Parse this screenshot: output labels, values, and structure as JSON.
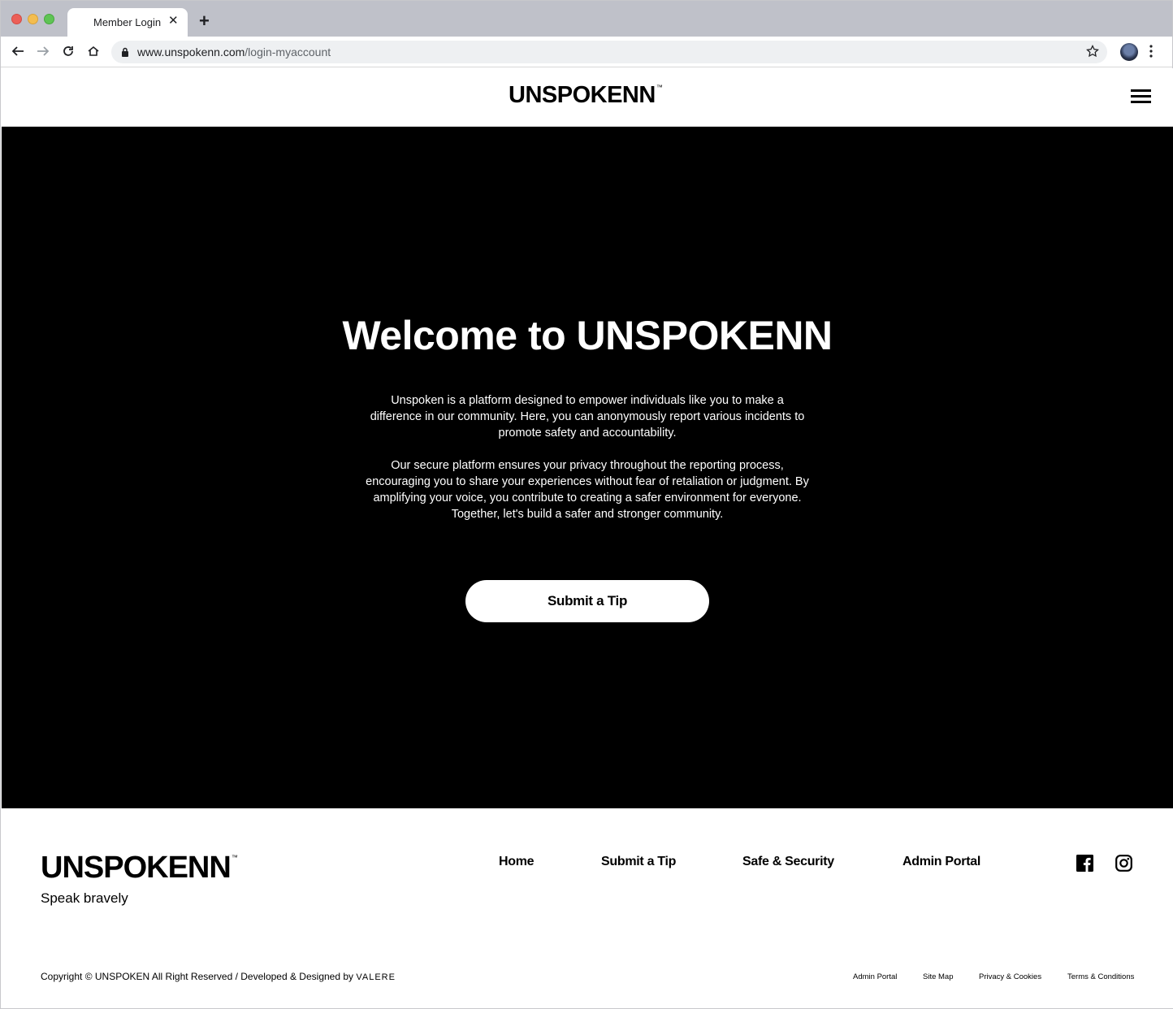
{
  "browser": {
    "tab_title": "Member Login",
    "tab_close": "✕",
    "new_tab": "+",
    "url_host": "www.unspokenn.com",
    "url_path": "/login-myaccount"
  },
  "header": {
    "logo": "UNSPOKENN",
    "logo_tm": "™"
  },
  "hero": {
    "title": "Welcome to UNSPOKENN",
    "paragraph1": "Unspoken is a platform designed to empower individuals like you to make a difference in our community. Here, you can anonymously report various incidents to promote safety and accountability.",
    "paragraph2": "Our secure platform ensures your privacy throughout the reporting process, encouraging you to share your experiences without fear of retaliation or judgment. By amplifying your voice, you contribute to creating a safer environment for everyone. Together, let's build a safer and stronger community.",
    "cta_label": "Submit a Tip"
  },
  "footer": {
    "logo": "UNSPOKENN",
    "logo_tm": "™",
    "tagline": "Speak bravely",
    "nav": [
      "Home",
      "Submit a Tip",
      "Safe & Security",
      "Admin Portal"
    ],
    "copyright": "Copyright © UNSPOKEN All Right Reserved   /   Developed & Designed by",
    "designer": "VALERE",
    "legal_links": [
      "Admin Portal",
      "Site Map",
      "Privacy & Cookies",
      "Terms & Conditions"
    ],
    "social": [
      "facebook-icon",
      "instagram-icon"
    ]
  }
}
